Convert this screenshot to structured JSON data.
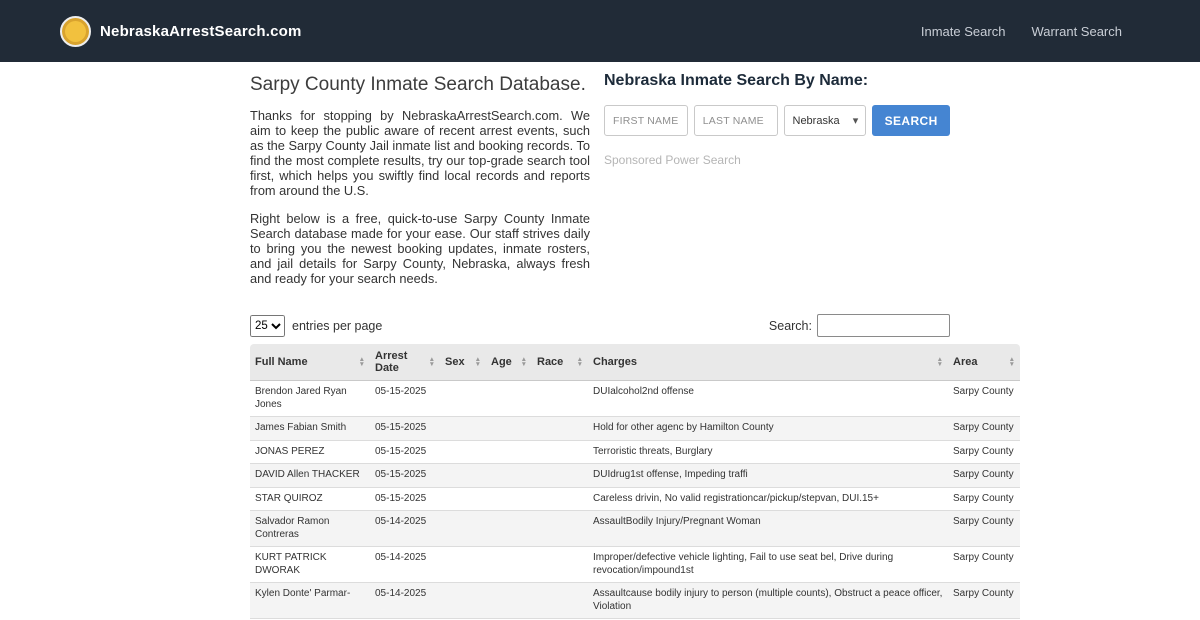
{
  "header": {
    "brand": "NebraskaArrestSearch.com",
    "nav": [
      {
        "label": "Inmate Search"
      },
      {
        "label": "Warrant Search"
      }
    ]
  },
  "intro": {
    "title": "Sarpy County Inmate Search Database.",
    "paragraphs": [
      "Thanks for stopping by NebraskaArrestSearch.com. We aim to keep the public aware of recent arrest events, such as the Sarpy County Jail inmate list and booking records. To find the most complete results, try our top-grade search tool first, which helps you swiftly find local records and reports from around the U.S.",
      "Right below is a free, quick-to-use Sarpy County Inmate Search database made for your ease. Our staff strives daily to bring you the newest booking updates, inmate rosters, and jail details for Sarpy County, Nebraska, always fresh and ready for your search needs."
    ]
  },
  "search_form": {
    "title": "Nebraska Inmate Search By Name:",
    "first_name_placeholder": "FIRST NAME",
    "last_name_placeholder": "LAST NAME",
    "state_selected": "Nebraska",
    "search_button": "SEARCH",
    "sponsored_note": "Sponsored Power Search"
  },
  "table_controls": {
    "page_size": "25",
    "entries_label": "entries per page",
    "search_label": "Search:",
    "search_value": ""
  },
  "table": {
    "columns": [
      "Full Name",
      "Arrest Date",
      "Sex",
      "Age",
      "Race",
      "Charges",
      "Area"
    ],
    "rows": [
      {
        "full_name": "Brendon Jared Ryan Jones",
        "arrest_date": "05-15-2025",
        "sex": "",
        "age": "",
        "race": "",
        "charges": "DUIalcohol2nd offense",
        "area": "Sarpy County"
      },
      {
        "full_name": "James Fabian Smith",
        "arrest_date": "05-15-2025",
        "sex": "",
        "age": "",
        "race": "",
        "charges": "Hold for other agenc by Hamilton County",
        "area": "Sarpy County"
      },
      {
        "full_name": "JONAS PEREZ",
        "arrest_date": "05-15-2025",
        "sex": "",
        "age": "",
        "race": "",
        "charges": "Terroristic threats, Burglary",
        "area": "Sarpy County"
      },
      {
        "full_name": "DAVID Allen THACKER",
        "arrest_date": "05-15-2025",
        "sex": "",
        "age": "",
        "race": "",
        "charges": "DUIdrug1st offense, Impeding traffi",
        "area": "Sarpy County"
      },
      {
        "full_name": "STAR QUIROZ",
        "arrest_date": "05-15-2025",
        "sex": "",
        "age": "",
        "race": "",
        "charges": "Careless drivin, No valid registrationcar/pickup/stepvan, DUI.15+",
        "area": "Sarpy County"
      },
      {
        "full_name": "Salvador Ramon Contreras",
        "arrest_date": "05-14-2025",
        "sex": "",
        "age": "",
        "race": "",
        "charges": "AssaultBodily Injury/Pregnant Woman",
        "area": "Sarpy County"
      },
      {
        "full_name": "KURT PATRICK DWORAK",
        "arrest_date": "05-14-2025",
        "sex": "",
        "age": "",
        "race": "",
        "charges": "Improper/defective vehicle lighting, Fail to use seat bel, Drive during revocation/impound1st",
        "area": "Sarpy County"
      },
      {
        "full_name": "Kylen Donte' Parmar-",
        "arrest_date": "05-14-2025",
        "sex": "",
        "age": "",
        "race": "",
        "charges": "Assaultcause bodily injury to person (multiple counts), Obstruct a peace officer, Violation",
        "area": "Sarpy County"
      }
    ]
  },
  "icons": {
    "sort": "▲\n▼",
    "caret_down": "▾",
    "logo": "gold-coin-circle"
  },
  "colors": {
    "topbar_bg": "#212b37",
    "accent_blue": "#4585d2",
    "logo_gold": "#f2c13e",
    "nav_link": "#c9ced6",
    "table_header_bg": "#e9e9e9",
    "row_alt_bg": "#f4f4f4",
    "text": "#333333",
    "muted": "#b5b5b5"
  }
}
